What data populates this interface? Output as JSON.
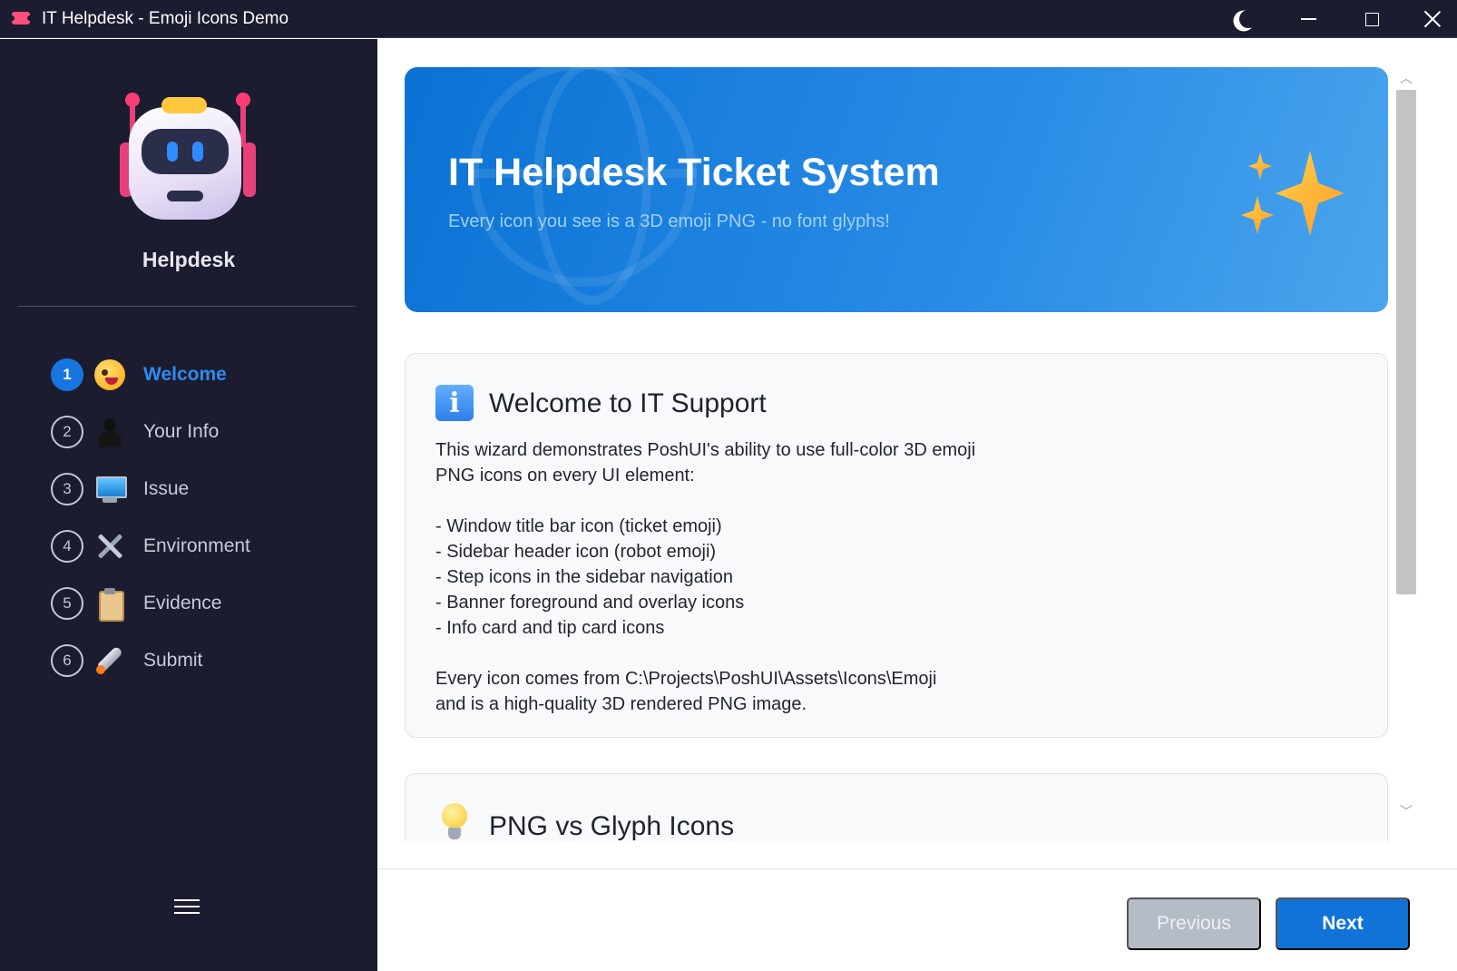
{
  "window": {
    "title": "IT Helpdesk - Emoji Icons Demo"
  },
  "sidebar": {
    "brand": "Helpdesk",
    "steps": [
      {
        "num": "1",
        "label": "Welcome",
        "icon": "grinning-face-emoji",
        "active": true
      },
      {
        "num": "2",
        "label": "Your Info",
        "icon": "person-silhouette-emoji",
        "active": false
      },
      {
        "num": "3",
        "label": "Issue",
        "icon": "desktop-computer-emoji",
        "active": false
      },
      {
        "num": "4",
        "label": "Environment",
        "icon": "hammer-and-wrench-emoji",
        "active": false
      },
      {
        "num": "5",
        "label": "Evidence",
        "icon": "clipboard-emoji",
        "active": false
      },
      {
        "num": "6",
        "label": "Submit",
        "icon": "rocket-emoji",
        "active": false
      }
    ]
  },
  "banner": {
    "title": "IT Helpdesk Ticket System",
    "subtitle": "Every icon you see is a 3D emoji PNG - no font glyphs!"
  },
  "info_card": {
    "title": "Welcome to IT Support",
    "line1": "This wizard demonstrates PoshUI's ability to use full-color 3D emoji",
    "line2": "PNG icons on every UI element:",
    "bullets": [
      "- Window title bar icon (ticket emoji)",
      "- Sidebar header icon (robot emoji)",
      "- Step icons in the sidebar navigation",
      "- Banner foreground and overlay icons",
      "- Info card and tip card icons"
    ],
    "line3": "Every icon comes from C:\\Projects\\PoshUI\\Assets\\Icons\\Emoji",
    "line4": "and is a high-quality 3D rendered PNG image."
  },
  "tip_card": {
    "title": "PNG vs Glyph Icons"
  },
  "footer": {
    "previous_label": "Previous",
    "next_label": "Next"
  },
  "colors": {
    "sidebar_bg": "#1b1c30",
    "accent": "#1976e0",
    "banner_start": "#0a72d4",
    "banner_end": "#4aa5ec"
  }
}
